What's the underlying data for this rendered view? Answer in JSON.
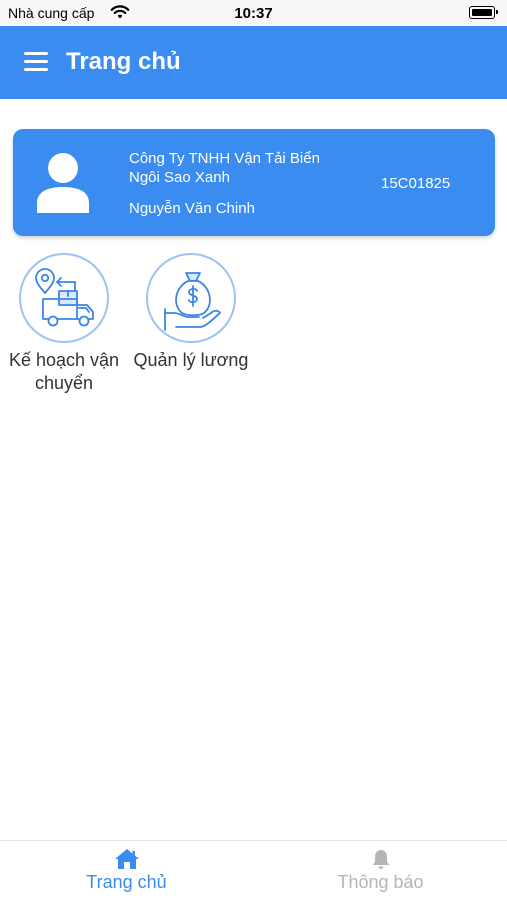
{
  "status_bar": {
    "carrier": "Nhà cung cấp",
    "time": "10:37"
  },
  "header": {
    "title": "Trang chủ"
  },
  "profile": {
    "company": "Công Ty TNHH Vận Tải Biển Ngôi Sao Xanh",
    "name": "Nguyễn Văn Chinh",
    "vehicle_plate": "15C01825"
  },
  "features": [
    {
      "label": "Kế hoạch vận chuyển",
      "icon": "transport-plan-icon"
    },
    {
      "label": "Quản lý lương",
      "icon": "salary-management-icon"
    }
  ],
  "tab_bar": {
    "home_label": "Trang chủ",
    "notifications_label": "Thông báo"
  },
  "colors": {
    "primary": "#3b8cf0",
    "icon_outline": "#3a86e8",
    "inactive_tab": "#b5b5b5"
  }
}
